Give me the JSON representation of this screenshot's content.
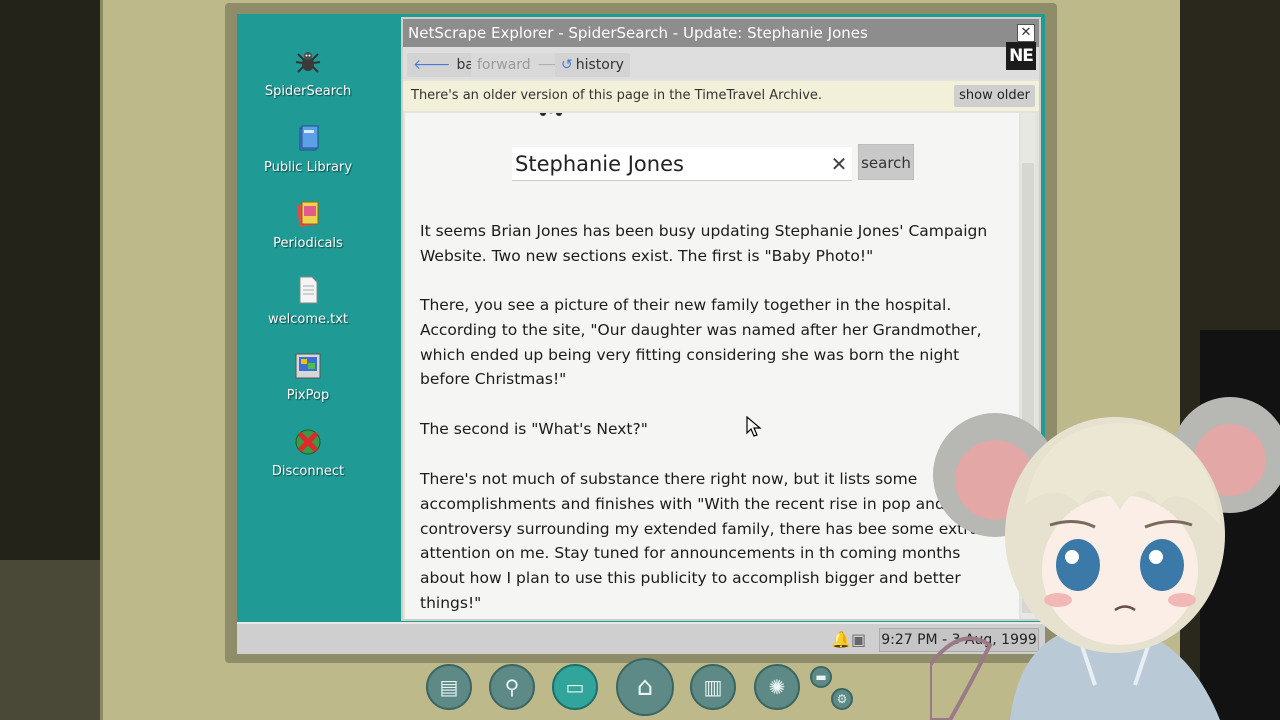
{
  "desktop": {
    "icons": [
      {
        "label": "SpiderSearch",
        "icon": "spider-icon"
      },
      {
        "label": "Public Library",
        "icon": "books-icon"
      },
      {
        "label": "Periodicals",
        "icon": "magazine-icon"
      },
      {
        "label": "welcome.txt",
        "icon": "text-file-icon"
      },
      {
        "label": "PixPop",
        "icon": "paint-icon"
      },
      {
        "label": "Disconnect",
        "icon": "disconnect-icon"
      }
    ]
  },
  "browser": {
    "title": "NetScrape Explorer - SpiderSearch - Update: Stephanie Jones",
    "close_label": "✕",
    "nav": {
      "back_label": "back",
      "forward_label": "forward",
      "history_label": "history"
    },
    "logo_text": "NE",
    "infobar": {
      "message": "There's an older version of this page in the TimeTravel Archive.",
      "show_older_label": "show older"
    },
    "search": {
      "value": "Stephanie Jones",
      "clear_label": "✕",
      "button_label": "search"
    },
    "paragraphs": [
      "It seems Brian Jones has been busy updating Stephanie Jones' Campaign Website. Two new sections exist. The first is \"Baby Photo!\"",
      "There, you see a picture of their new family together in the hospital. According to the site, \"Our daughter was named after her Grandmother, which ended up being very fitting considering she was born the night before Christmas!\"",
      "The second is \"What's Next?\"",
      "There's not much of substance there right now, but it lists some accomplishments and finishes with \"With the recent rise in pop and controversy surrounding my extended family, there has bee some extra attention on me. Stay tuned for announcements in th coming months about how I plan to use this publicity to accomplish bigger and better things!\""
    ]
  },
  "taskbar": {
    "clock": "9:27 PM - 3 Aug, 1999"
  },
  "dock": {
    "buttons": [
      "files-icon",
      "detective-icon",
      "computer-icon",
      "home-icon",
      "notebook-icon",
      "lightbulb-icon",
      "keyboard-icon",
      "settings-icon"
    ]
  },
  "colors": {
    "desktop_bg": "#1f9a94",
    "window_title_bg": "#8d8d8d",
    "infobar_bg": "#f2f0d8",
    "dock_active": "#31a59c"
  }
}
